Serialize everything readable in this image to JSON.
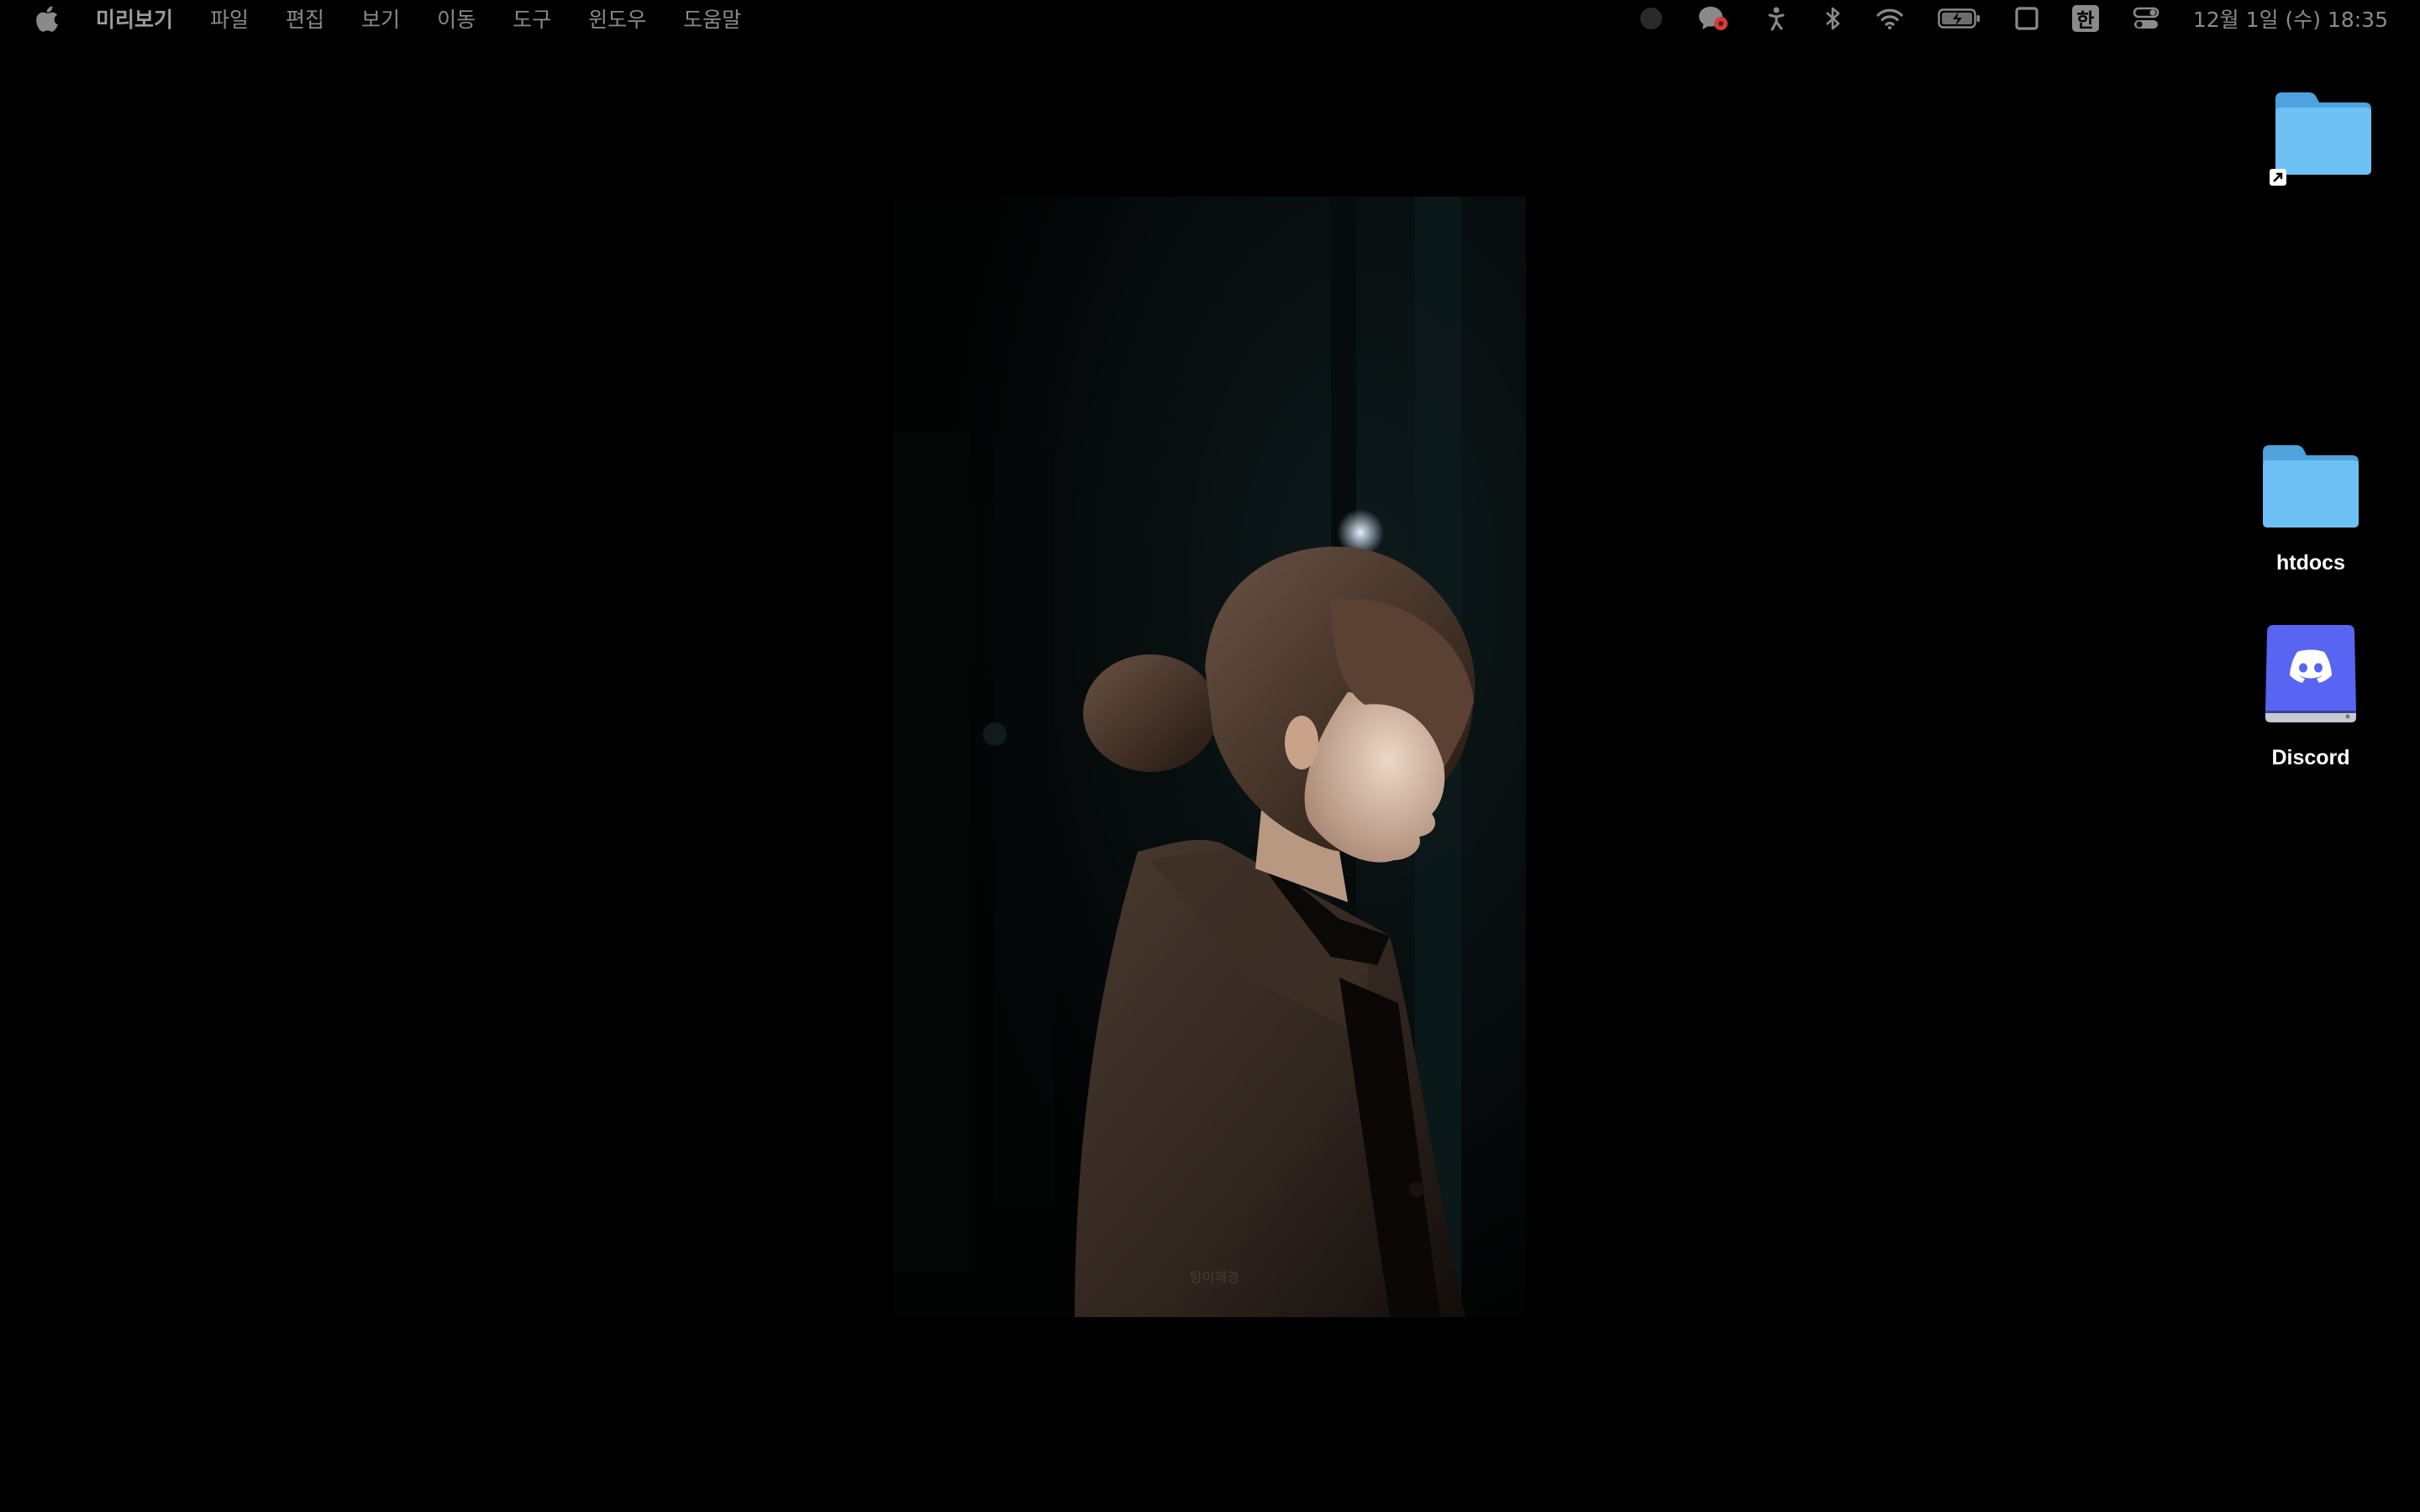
{
  "menubar": {
    "app_name": "미리보기",
    "menus": [
      "파일",
      "편집",
      "보기",
      "이동",
      "도구",
      "윈도우",
      "도움말"
    ],
    "status_icons": [
      "record-icon",
      "chat-notification-icon",
      "accessibility-icon",
      "bluetooth-icon",
      "wifi-icon",
      "battery-icon",
      "window-icon",
      "input-source-icon",
      "control-center-icon"
    ],
    "input_source_label": "한",
    "clock": "12월 1일 (수)  18:35"
  },
  "preview": {
    "watermark": "탕이해경"
  },
  "desktop": {
    "items": [
      {
        "label": "",
        "icon": "folder-icon",
        "alias": true
      },
      {
        "label": "htdocs",
        "icon": "folder-icon"
      },
      {
        "label": "Discord",
        "icon": "discord-drive-icon"
      }
    ]
  },
  "colors": {
    "background": "#000000",
    "menu_text": "#8a8a8a",
    "folder_blue": "#5fb3ea",
    "discord_blurple": "#5865f2"
  }
}
